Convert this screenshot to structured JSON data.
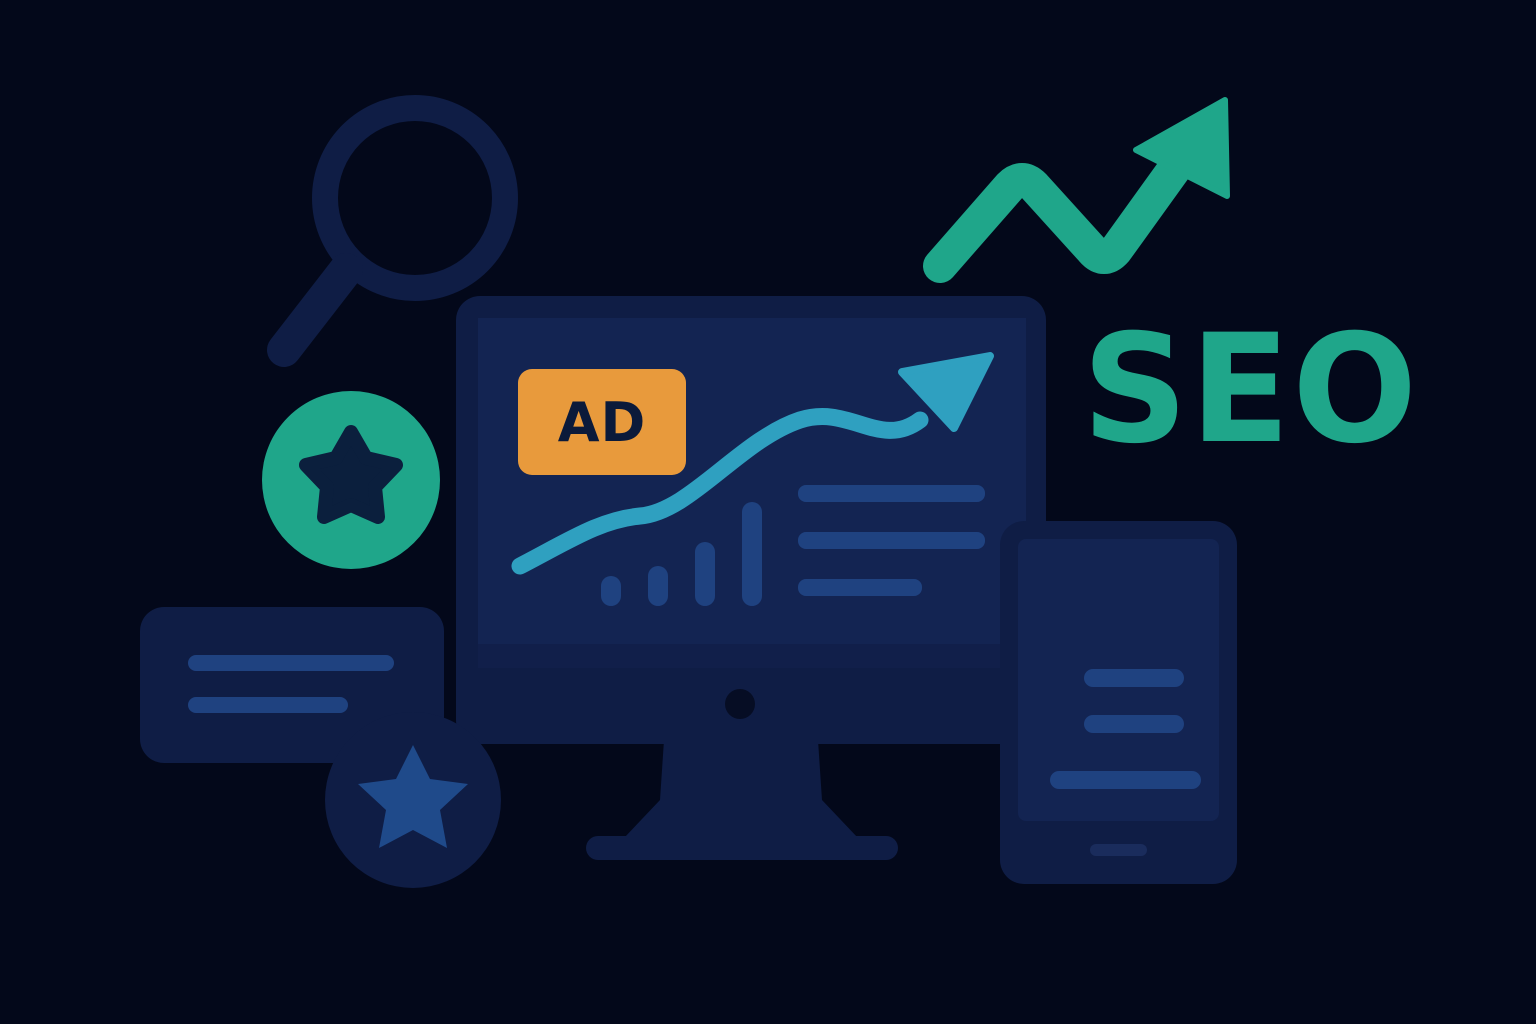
{
  "illustration": {
    "ad_badge": {
      "label": "AD",
      "background_color": "#e89a3c",
      "text_color": "#0b1a3a"
    },
    "seo_label": {
      "text": "SEO",
      "color": "#1fa68a"
    },
    "icons": [
      "magnifier-icon",
      "star-icon",
      "trend-arrow-icon",
      "monitor-icon",
      "phone-icon",
      "card-icon"
    ],
    "colors": {
      "background": "#03081a",
      "panel_dark": "#0f1d45",
      "panel_screen": "#132452",
      "placeholder_line": "#1f4280",
      "accent_green": "#1fa68a",
      "accent_blue": "#2fa0c0",
      "star_blue": "#1f4a8a"
    }
  }
}
